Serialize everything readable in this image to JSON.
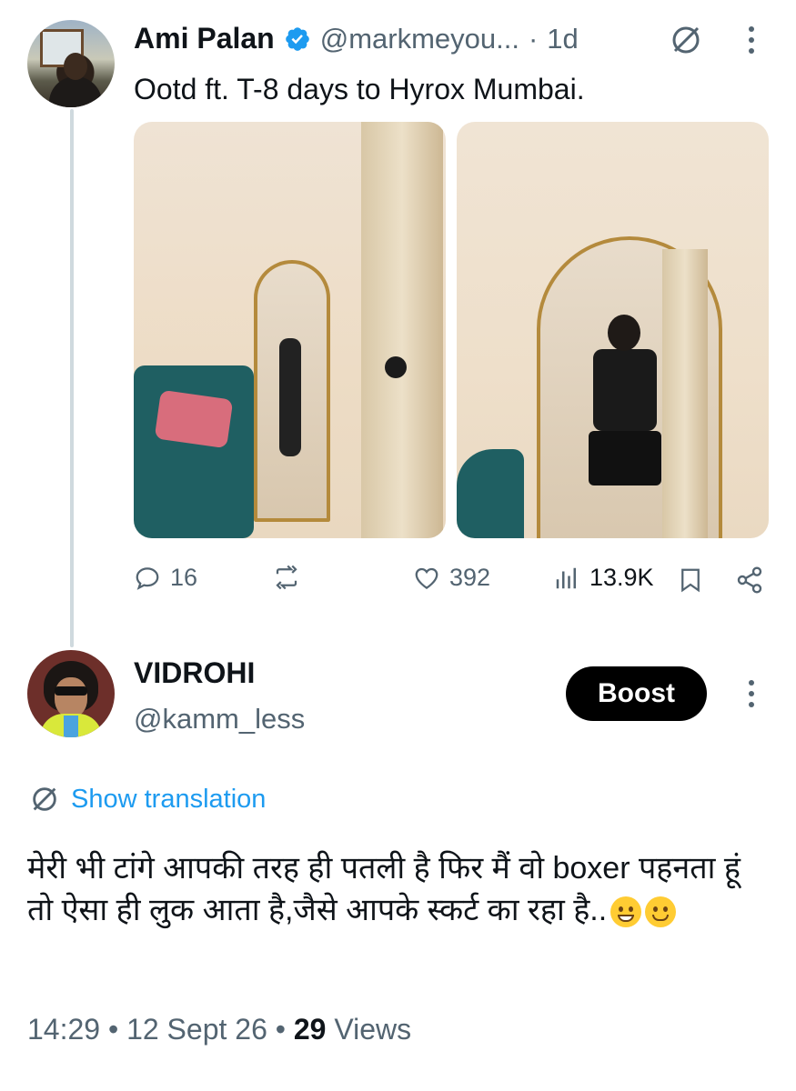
{
  "tweet": {
    "author_name": "Ami Palan",
    "author_handle": "@markmeyou...",
    "separator": "·",
    "time": "1d",
    "text": "Ootd ft. T-8 days to Hyrox Mumbai.",
    "stats": {
      "replies": "16",
      "reposts": "",
      "likes": "392",
      "views": "13.9K"
    }
  },
  "reply": {
    "author_name": "VIDROHI",
    "author_handle": "@kamm_less",
    "boost_label": "Boost",
    "show_translation": "Show translation",
    "text": "मेरी भी टांगे आपकी तरह ही पतली है फिर मैं वो boxer पहनता हूं तो ऐसा ही लुक आता है,जैसे आपके स्कर्ट का रहा है..",
    "emojis": [
      "grinning-face-emoji",
      "smiling-face-emoji"
    ],
    "meta": {
      "time": "14:29",
      "dot": "•",
      "date": "12 Sept 26",
      "views_count": "29",
      "views_label": "Views"
    }
  },
  "colors": {
    "link": "#1d9bf0",
    "muted": "#536471",
    "verified": "#1d9bf0",
    "boost_bg": "#000000"
  }
}
